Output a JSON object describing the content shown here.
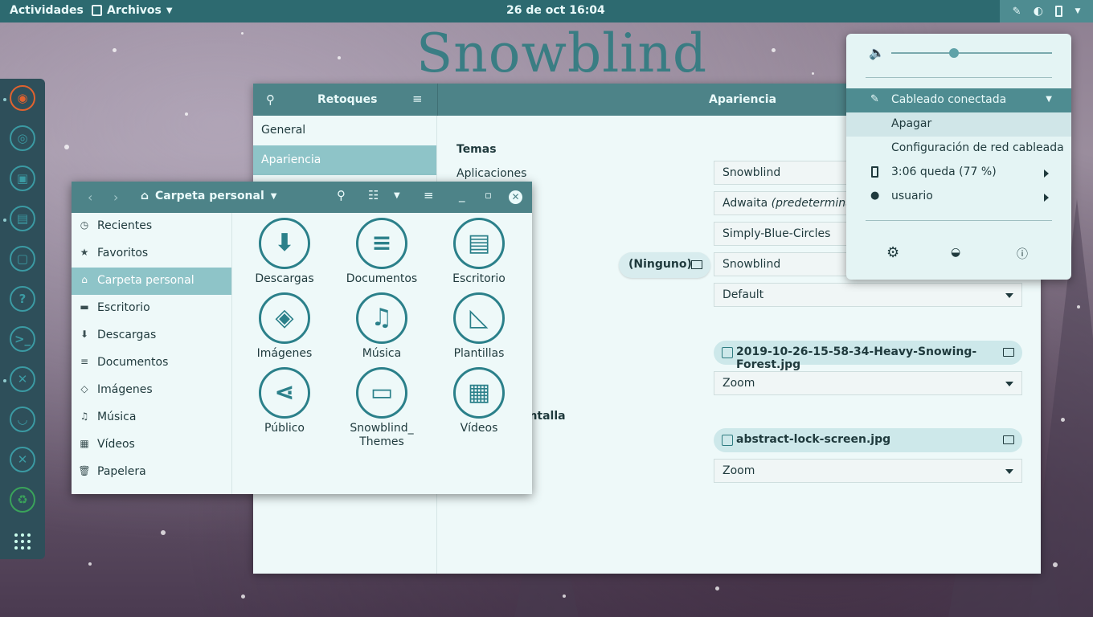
{
  "topbar": {
    "activities": "Actividades",
    "app_menu": "Archivos",
    "clock": "26 de oct  16:04"
  },
  "wallpaper_logo": "Snowblind",
  "tweaks": {
    "title": "Retoques",
    "page_title": "Apariencia",
    "sidebar": [
      {
        "label": "General",
        "selected": false
      },
      {
        "label": "Apariencia",
        "selected": true
      }
    ],
    "section_themes": "Temas",
    "label_applications": "Aplicaciones",
    "section_lock_partial": "antalla",
    "rows": [
      {
        "value": "Snowblind"
      },
      {
        "value_plain": "Adwaita ",
        "value_italic": "(predeterminado)"
      },
      {
        "value": "Simply-Blue-Circles"
      },
      {
        "value": "Snowblind"
      },
      {
        "value": "Default"
      }
    ],
    "shell_theme_button": "(Ninguno)",
    "background_image": "2019-10-26-15-58-34-Heavy-Snowing-Forest.jpg",
    "background_adjust": "Zoom",
    "lock_image": "abstract-lock-screen.jpg",
    "lock_adjust": "Zoom"
  },
  "files": {
    "path": "Carpeta personal",
    "sidebar": [
      {
        "label": "Recientes",
        "icon": "clock-icon",
        "glyph": "◷",
        "selected": false
      },
      {
        "label": "Favoritos",
        "icon": "star-icon",
        "glyph": "★",
        "selected": false
      },
      {
        "label": "Carpeta personal",
        "icon": "home-icon",
        "glyph": "⌂",
        "selected": true
      },
      {
        "label": "Escritorio",
        "icon": "desktop-icon",
        "glyph": "▬",
        "selected": false
      },
      {
        "label": "Descargas",
        "icon": "download-icon",
        "glyph": "⬇",
        "selected": false
      },
      {
        "label": "Documentos",
        "icon": "document-icon",
        "glyph": "≡",
        "selected": false
      },
      {
        "label": "Imágenes",
        "icon": "image-icon",
        "glyph": "◇",
        "selected": false
      },
      {
        "label": "Música",
        "icon": "music-icon",
        "glyph": "♫",
        "selected": false
      },
      {
        "label": "Vídeos",
        "icon": "video-icon",
        "glyph": "▦",
        "selected": false
      },
      {
        "label": "Papelera",
        "icon": "trash-icon",
        "glyph": "🗑",
        "selected": false
      }
    ],
    "folders": [
      {
        "label": "Descargas",
        "icon": "download-folder-icon",
        "glyph": "⬇"
      },
      {
        "label": "Documentos",
        "icon": "documents-folder-icon",
        "glyph": "≡"
      },
      {
        "label": "Escritorio",
        "icon": "desktop-folder-icon",
        "glyph": "▤"
      },
      {
        "label": "Imágenes",
        "icon": "pictures-folder-icon",
        "glyph": "◈"
      },
      {
        "label": "Música",
        "icon": "music-folder-icon",
        "glyph": "♫"
      },
      {
        "label": "Plantillas",
        "icon": "templates-folder-icon",
        "glyph": "◺"
      },
      {
        "label": "Público",
        "icon": "public-folder-icon",
        "glyph": "⋖"
      },
      {
        "label": "Snowblind_ Themes",
        "icon": "folder-icon",
        "glyph": "▭"
      },
      {
        "label": "Vídeos",
        "icon": "videos-folder-icon",
        "glyph": "▦"
      }
    ]
  },
  "system_menu": {
    "volume_fraction": 0.39,
    "network": "Cableado conectada",
    "turn_off": "Apagar",
    "wired_settings": "Configuración de red cableada",
    "battery": "3:06 queda (77 %)",
    "user": "usuario"
  },
  "colors": {
    "accent": "#2d6a70",
    "header": "#4d8388",
    "selected": "#8ec4c8",
    "icon_teal": "#2b808a"
  }
}
